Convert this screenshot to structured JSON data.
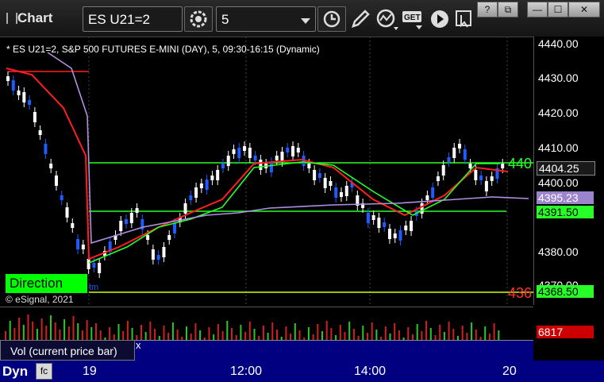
{
  "app": {
    "title": "Chart"
  },
  "toolbar": {
    "symbol": "ES U21=2",
    "interval": "5",
    "icons": [
      "link-settings-icon",
      "clock-icon",
      "pencil-icon",
      "study-icon",
      "get-icon",
      "play-icon",
      "cursor-icon"
    ]
  },
  "window": {
    "help": "?",
    "restore": "⧉",
    "minimize": "—",
    "maximize": "☐",
    "close": "✕"
  },
  "chart": {
    "legend": "* ES U21=2, S&P 500 FUTURES E-MINI (DAY), 5, 09:30-16:15 (Dynamic)",
    "copyright": "© eSignal, 2021",
    "direction_label": "Direction",
    "partial_label_tm": "tm",
    "right_clip_green": "440",
    "right_clip_red": "436",
    "price_labels": [
      "4440.00",
      "4430.00",
      "4420.00",
      "4410.00",
      "4400.00",
      "4380.00",
      "4370.00"
    ],
    "price_tags": {
      "last": "4404.25",
      "purple": "4395.23",
      "green": "4391.50",
      "lower_green": "4368.50"
    },
    "colors": {
      "up": "#ffffff",
      "down": "#1e5cff",
      "red_ma": "#ff1e1e",
      "green_ma": "#28ff28",
      "purple_ma": "#b090e0",
      "level_green": "#28ff28",
      "level_yellow": "#c8ff00"
    }
  },
  "volume": {
    "label": "Vol (current price bar)",
    "value": "6817",
    "close": "x"
  },
  "time_axis": {
    "left_label": "Dyn",
    "ticks": [
      "19",
      "12:00",
      "14:00",
      "20"
    ]
  }
}
